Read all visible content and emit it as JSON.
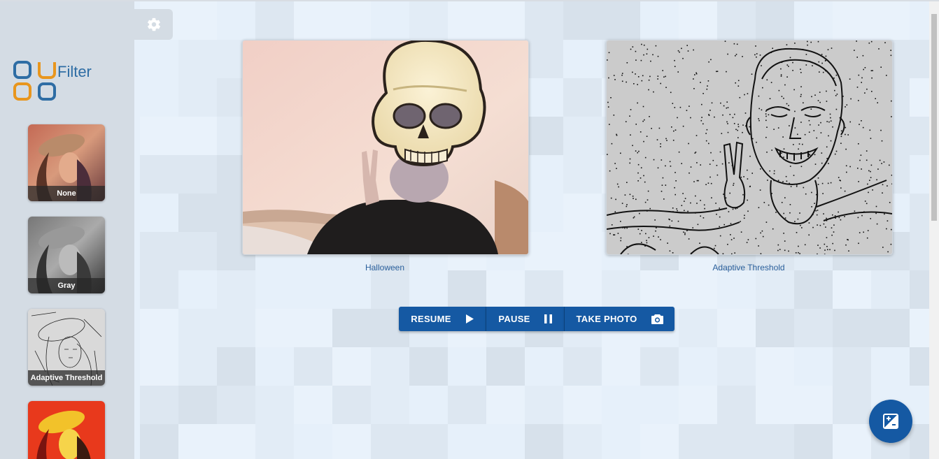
{
  "app": {
    "logo_text": "Filter",
    "brand_colors": {
      "blue": "#2e6da4",
      "orange": "#e8961e"
    }
  },
  "sidebar": {
    "filters": [
      {
        "label": "None"
      },
      {
        "label": "Gray"
      },
      {
        "label": "Adaptive Threshold"
      },
      {
        "label": ""
      }
    ]
  },
  "views": {
    "left": {
      "caption": "Halloween"
    },
    "right": {
      "caption": "Adaptive Threshold"
    }
  },
  "controls": {
    "resume_label": "RESUME",
    "pause_label": "PAUSE",
    "take_photo_label": "TAKE PHOTO",
    "accent": "#1559a3"
  },
  "icons": {
    "settings": "gear-icon",
    "resume": "play-icon",
    "pause": "pause-icon",
    "take_photo": "camera-icon",
    "fab": "image-filter-icon"
  }
}
